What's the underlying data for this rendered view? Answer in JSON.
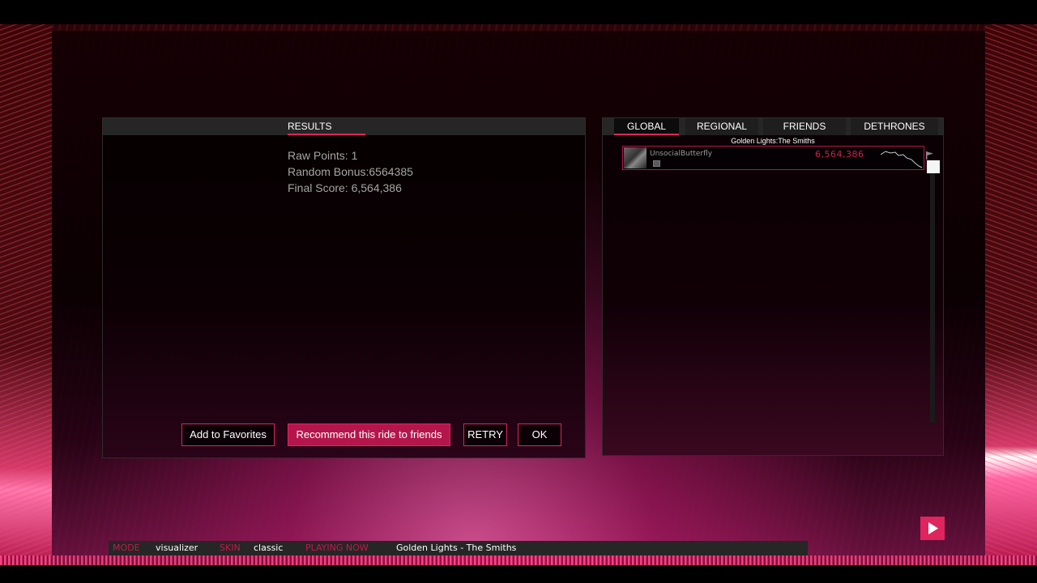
{
  "results": {
    "tab_label": "RESULTS",
    "raw_points": "Raw Points: 1",
    "random_bonus": "Random Bonus:6564385",
    "final_score": "Final Score: 6,564,386",
    "buttons": {
      "favorites": "Add to Favorites",
      "recommend": "Recommend this ride to friends",
      "retry": "RETRY",
      "ok": "OK"
    }
  },
  "leaderboard": {
    "tabs": [
      "GLOBAL",
      "REGIONAL",
      "FRIENDS",
      "DETHRONES"
    ],
    "active_tab": "GLOBAL",
    "song": "Golden Lights:The Smiths",
    "entries": [
      {
        "name": "UnsocialButterfly",
        "score": "6,564,386"
      }
    ]
  },
  "status": {
    "mode_label": "MODE",
    "mode_value": "visualizer",
    "skin_label": "SKIN",
    "skin_value": "classic",
    "playing_label": "PLAYING NOW",
    "playing_value": "Golden Lights - The Smiths"
  },
  "colors": {
    "accent": "#e0245e",
    "button_fill": "#b4164c",
    "score_text": "#d11f55"
  },
  "icons": {
    "next": "play-arrow-icon",
    "flag": "flag-icon",
    "badge": "badge-icon"
  }
}
